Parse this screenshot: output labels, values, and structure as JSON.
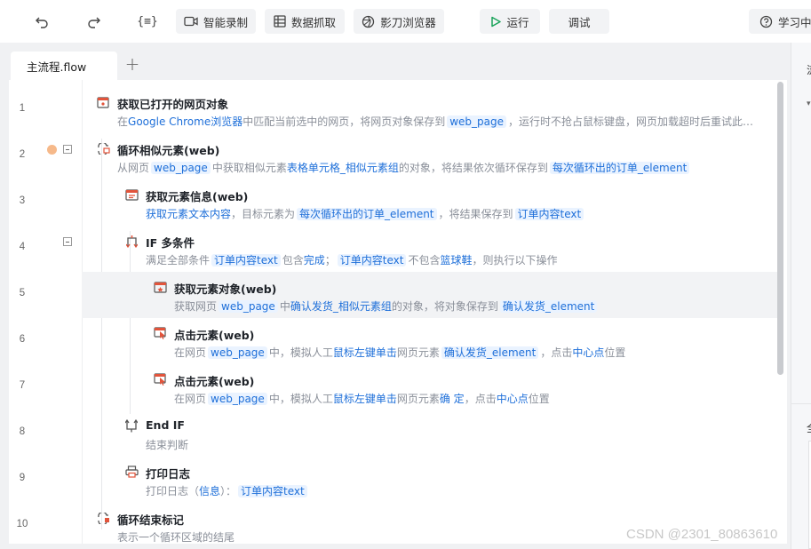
{
  "toolbar": {
    "undo_icon": "undo-icon",
    "redo_icon": "redo-icon",
    "variable_icon": "variable-braces-icon",
    "variable_glyph": "{≡}",
    "smart_record_label": "智能录制",
    "data_extract_label": "数据抓取",
    "browser_label": "影刀浏览器",
    "run_label": "运行",
    "debug_label": "调试",
    "learn_label": "学习中"
  },
  "tabs": {
    "active_label": "主流程.flow",
    "add_symbol": "+"
  },
  "right_panel": {
    "top_char": "流",
    "bottom_char": "全"
  },
  "rows": [
    {
      "no": "1",
      "title": "获取已打开的网页对象",
      "desc": [
        {
          "t": "在",
          "k": "n"
        },
        {
          "t": "Google Chrome浏览器",
          "k": "b"
        },
        {
          "t": "中匹配当前选中的网页，将网页对象保存到",
          "k": "n"
        },
        {
          "t": "web_page",
          "k": "c"
        },
        {
          "t": "，运行时不抢占鼠标键盘，网页加载超时后重试此…",
          "k": "n"
        }
      ]
    },
    {
      "no": "2",
      "title": "循环相似元素(web)",
      "desc": [
        {
          "t": "从网页",
          "k": "n"
        },
        {
          "t": "web_page",
          "k": "c"
        },
        {
          "t": "中获取相似元素",
          "k": "n"
        },
        {
          "t": "表格单元格_相似元素组",
          "k": "b"
        },
        {
          "t": "的对象，将结果依次循环保存到",
          "k": "n"
        },
        {
          "t": "每次循环出的订单_element",
          "k": "c"
        }
      ]
    },
    {
      "no": "3",
      "title": "获取元素信息(web)",
      "desc": [
        {
          "t": "获取元素文本内容",
          "k": "b"
        },
        {
          "t": "，目标元素为",
          "k": "n"
        },
        {
          "t": "每次循环出的订单_element",
          "k": "c"
        },
        {
          "t": "，将结果保存到",
          "k": "n"
        },
        {
          "t": "订单内容text",
          "k": "c"
        }
      ]
    },
    {
      "no": "4",
      "title": "IF 多条件",
      "desc": [
        {
          "t": "满足全部条件",
          "k": "n"
        },
        {
          "t": "订单内容text",
          "k": "c"
        },
        {
          "t": "包含",
          "k": "n"
        },
        {
          "t": "完成",
          "k": "b"
        },
        {
          "t": "；",
          "k": "n"
        },
        {
          "t": "订单内容text",
          "k": "c"
        },
        {
          "t": "不包含",
          "k": "n"
        },
        {
          "t": "篮球鞋",
          "k": "b"
        },
        {
          "t": "，则执行以下操作",
          "k": "n"
        }
      ]
    },
    {
      "no": "5",
      "title": "获取元素对象(web)",
      "desc": [
        {
          "t": "获取网页",
          "k": "n"
        },
        {
          "t": "web_page",
          "k": "c"
        },
        {
          "t": "中",
          "k": "n"
        },
        {
          "t": "确认发货_相似元素组",
          "k": "b"
        },
        {
          "t": "的对象，将对象保存到",
          "k": "n"
        },
        {
          "t": "确认发货_element",
          "k": "c"
        }
      ]
    },
    {
      "no": "6",
      "title": "点击元素(web)",
      "desc": [
        {
          "t": "在网页",
          "k": "n"
        },
        {
          "t": "web_page",
          "k": "c"
        },
        {
          "t": "中，模拟人工",
          "k": "n"
        },
        {
          "t": "鼠标左键单击",
          "k": "b"
        },
        {
          "t": "网页元素",
          "k": "n"
        },
        {
          "t": "确认发货_element",
          "k": "c"
        },
        {
          "t": "，点击",
          "k": "n"
        },
        {
          "t": "中心点",
          "k": "b"
        },
        {
          "t": "位置",
          "k": "n"
        }
      ]
    },
    {
      "no": "7",
      "title": "点击元素(web)",
      "desc": [
        {
          "t": "在网页",
          "k": "n"
        },
        {
          "t": "web_page",
          "k": "c"
        },
        {
          "t": "中，模拟人工",
          "k": "n"
        },
        {
          "t": "鼠标左键单击",
          "k": "b"
        },
        {
          "t": "网页元素",
          "k": "n"
        },
        {
          "t": "确 定",
          "k": "b"
        },
        {
          "t": "，点击",
          "k": "n"
        },
        {
          "t": "中心点",
          "k": "b"
        },
        {
          "t": "位置",
          "k": "n"
        }
      ]
    },
    {
      "no": "8",
      "title": "End IF",
      "desc": [
        {
          "t": "结束判断",
          "k": "n"
        }
      ]
    },
    {
      "no": "9",
      "title": "打印日志",
      "desc": [
        {
          "t": "打印日志（",
          "k": "n"
        },
        {
          "t": "信息",
          "k": "b"
        },
        {
          "t": "）：",
          "k": "n"
        },
        {
          "t": "订单内容text",
          "k": "c"
        }
      ]
    },
    {
      "no": "10",
      "title": "循环结束标记",
      "desc": [
        {
          "t": "表示一个循环区域的结尾",
          "k": "n"
        }
      ]
    }
  ],
  "watermark": "CSDN @2301_80863610"
}
